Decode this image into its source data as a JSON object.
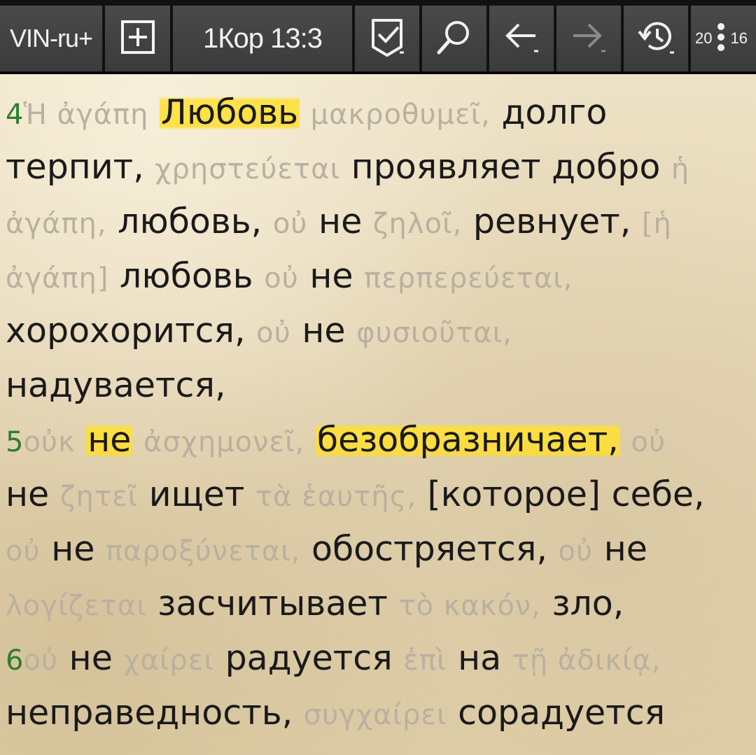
{
  "toolbar": {
    "translation_label": "VIN-ru+",
    "reference": "1Кор 13:3",
    "page_indicator_left": "20",
    "page_indicator_right": "16",
    "icons": [
      "add-tab-icon",
      "bookmark-check-icon",
      "search-icon",
      "back-arrow-icon",
      "forward-arrow-icon",
      "history-icon",
      "more-vert-icon"
    ]
  },
  "colors": {
    "verse_number": "#2f7d2f",
    "greek_text": "#b9b0a0",
    "highlight": "#ffe132",
    "toolbar_bg": "#3b3b3b"
  },
  "verses": [
    {
      "lines": [
        [
          {
            "t": "num",
            "v": "4"
          },
          {
            "t": "gk",
            "v": "Ἡ ἀγάπη"
          },
          {
            "t": "ru",
            "v": "Любовь",
            "hl": true
          },
          {
            "t": "gk",
            "v": "μακροθυμεῖ,"
          },
          {
            "t": "ru",
            "v": "долго"
          }
        ],
        [
          {
            "t": "ru",
            "v": "терпит,"
          },
          {
            "t": "gk",
            "v": "χρηστεύεται"
          },
          {
            "t": "ru",
            "v": "проявляет добро"
          },
          {
            "t": "gk",
            "v": "ἡ"
          }
        ],
        [
          {
            "t": "gk",
            "v": "ἀγάπη,"
          },
          {
            "t": "ru",
            "v": "любовь,"
          },
          {
            "t": "gk",
            "v": "οὐ"
          },
          {
            "t": "ru",
            "v": "не"
          },
          {
            "t": "gk",
            "v": "ζηλοῖ,"
          },
          {
            "t": "ru",
            "v": "ревнует,"
          },
          {
            "t": "gk",
            "v": "[ἡ"
          }
        ],
        [
          {
            "t": "gk",
            "v": "ἀγάπη]"
          },
          {
            "t": "ru",
            "v": "любовь"
          },
          {
            "t": "gk",
            "v": "οὐ"
          },
          {
            "t": "ru",
            "v": "не"
          },
          {
            "t": "gk",
            "v": "περπερεύεται,"
          }
        ],
        [
          {
            "t": "ru",
            "v": "хорохорится,"
          },
          {
            "t": "gk",
            "v": "οὐ"
          },
          {
            "t": "ru",
            "v": "не"
          },
          {
            "t": "gk",
            "v": "φυσιοῦται,"
          }
        ],
        [
          {
            "t": "ru",
            "v": "надувается,"
          }
        ]
      ]
    },
    {
      "lines": [
        [
          {
            "t": "num",
            "v": "5"
          },
          {
            "t": "gk",
            "v": "οὐκ"
          },
          {
            "t": "ru",
            "v": "не",
            "hl": true
          },
          {
            "t": "gk",
            "v": "ἀσχημονεῖ,"
          },
          {
            "t": "ru",
            "v": "безобразничает,",
            "hl": true
          },
          {
            "t": "gk",
            "v": "οὐ"
          }
        ],
        [
          {
            "t": "ru",
            "v": "не"
          },
          {
            "t": "gk",
            "v": "ζητεῖ"
          },
          {
            "t": "ru",
            "v": "ищет"
          },
          {
            "t": "gk",
            "v": "τὰ ἑαυτῆς,"
          },
          {
            "t": "ru",
            "v": "[которое] себе,"
          }
        ],
        [
          {
            "t": "gk",
            "v": "οὐ"
          },
          {
            "t": "ru",
            "v": "не"
          },
          {
            "t": "gk",
            "v": "παροξύνεται,"
          },
          {
            "t": "ru",
            "v": "обостряется,"
          },
          {
            "t": "gk",
            "v": "οὐ"
          },
          {
            "t": "ru",
            "v": "не"
          }
        ],
        [
          {
            "t": "gk",
            "v": "λογίζεται"
          },
          {
            "t": "ru",
            "v": "засчитывает"
          },
          {
            "t": "gk",
            "v": "τὸ κακόν,"
          },
          {
            "t": "ru",
            "v": "зло,"
          }
        ]
      ]
    },
    {
      "lines": [
        [
          {
            "t": "num",
            "v": "6"
          },
          {
            "t": "gk",
            "v": "οὐ"
          },
          {
            "t": "ru",
            "v": "не"
          },
          {
            "t": "gk",
            "v": "χαίρει"
          },
          {
            "t": "ru",
            "v": "радуется"
          },
          {
            "t": "gk",
            "v": "ἐπὶ"
          },
          {
            "t": "ru",
            "v": "на"
          },
          {
            "t": "gk",
            "v": "τῇ ἀδικίᾳ,"
          }
        ],
        [
          {
            "t": "ru",
            "v": "неправедность,"
          },
          {
            "t": "gk",
            "v": "συγχαίρει"
          },
          {
            "t": "ru",
            "v": "сорадуется"
          }
        ]
      ]
    }
  ]
}
